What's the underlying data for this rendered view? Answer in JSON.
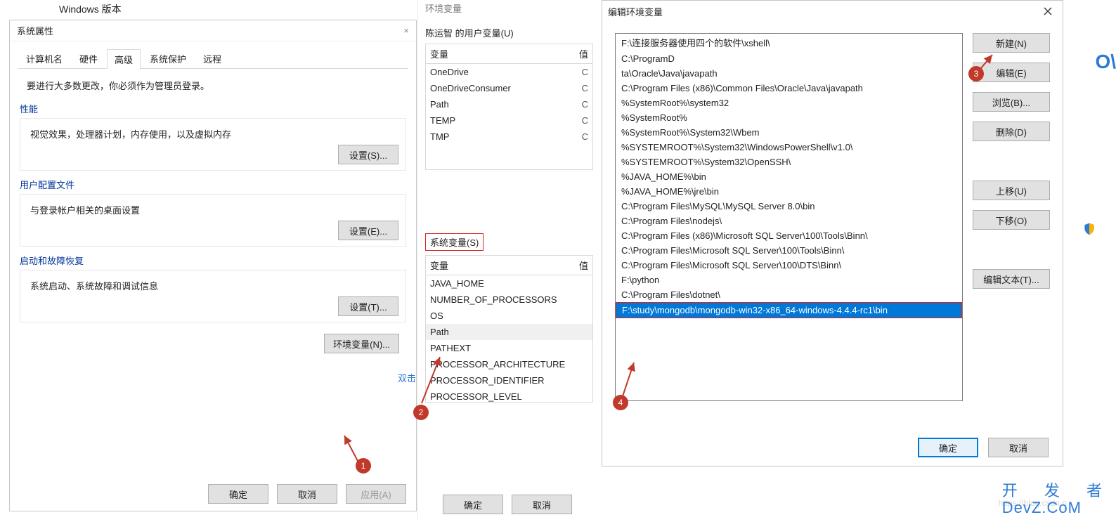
{
  "top_label": "Windows 版本",
  "dlg1": {
    "title": "系统属性",
    "tabs": [
      "计算机名",
      "硬件",
      "高级",
      "系统保护",
      "远程"
    ],
    "active_tab": "高级",
    "note": "要进行大多数更改，你必须作为管理员登录。",
    "perf": {
      "title": "性能",
      "desc": "视觉效果，处理器计划，内存使用，以及虚拟内存",
      "btn": "设置(S)..."
    },
    "profile": {
      "title": "用户配置文件",
      "desc": "与登录帐户相关的桌面设置",
      "btn": "设置(E)..."
    },
    "startup": {
      "title": "启动和故障恢复",
      "desc": "系统启动、系统故障和调试信息",
      "btn": "设置(T)..."
    },
    "env_btn": "环境变量(N)...",
    "ok": "确定",
    "cancel": "取消",
    "apply": "应用(A)"
  },
  "dlg2": {
    "hdr": "环境变量",
    "user_title": "陈运智 的用户变量(U)",
    "col1": "变量",
    "col2_partial": "值",
    "user_rows": [
      "OneDrive",
      "OneDriveConsumer",
      "Path",
      "TEMP",
      "TMP"
    ],
    "sys_title": "系统变量(S)",
    "sys_rows": [
      "JAVA_HOME",
      "NUMBER_OF_PROCESSORS",
      "OS",
      "Path",
      "PATHEXT",
      "PROCESSOR_ARCHITECTURE",
      "PROCESSOR_IDENTIFIER",
      "PROCESSOR_LEVEL"
    ],
    "selected_sys": "Path",
    "ok": "确定",
    "cancel": "取消"
  },
  "dlg3": {
    "title": "编辑环境变量",
    "paths": [
      "F:\\连接服务器使用四个的软件\\xshell\\",
      "C:\\ProgramD",
      "ta\\Oracle\\Java\\javapath",
      "C:\\Program Files (x86)\\Common Files\\Oracle\\Java\\javapath",
      "%SystemRoot%\\system32",
      "%SystemRoot%",
      "%SystemRoot%\\System32\\Wbem",
      "%SYSTEMROOT%\\System32\\WindowsPowerShell\\v1.0\\",
      "%SYSTEMROOT%\\System32\\OpenSSH\\",
      "%JAVA_HOME%\\bin",
      "%JAVA_HOME%\\jre\\bin",
      "C:\\Program Files\\MySQL\\MySQL Server 8.0\\bin",
      "C:\\Program Files\\nodejs\\",
      "C:\\Program Files (x86)\\Microsoft SQL Server\\100\\Tools\\Binn\\",
      "C:\\Program Files\\Microsoft SQL Server\\100\\Tools\\Binn\\",
      "C:\\Program Files\\Microsoft SQL Server\\100\\DTS\\Binn\\",
      "F:\\python",
      "C:\\Program Files\\dotnet\\",
      "F:\\study\\mongodb\\mongodb-win32-x86_64-windows-4.4.4-rc1\\bin"
    ],
    "selected_index": 18,
    "btns": {
      "new": "新建(N)",
      "edit": "编辑(E)",
      "browse": "浏览(B)...",
      "del": "删除(D)",
      "up": "上移(U)",
      "down": "下移(O)",
      "edit_text": "编辑文本(T)..."
    },
    "ok": "确定",
    "cancel": "取消"
  },
  "annotations": {
    "dblclick": "双击",
    "b1": "1",
    "b2": "2",
    "b3": "3",
    "b4": "4"
  },
  "decor": {
    "ov": "O\\",
    "devz_cn": "开 发 者",
    "devz_en": "DevZ.CoM",
    "watermark": "https://blog.csdn.n"
  }
}
